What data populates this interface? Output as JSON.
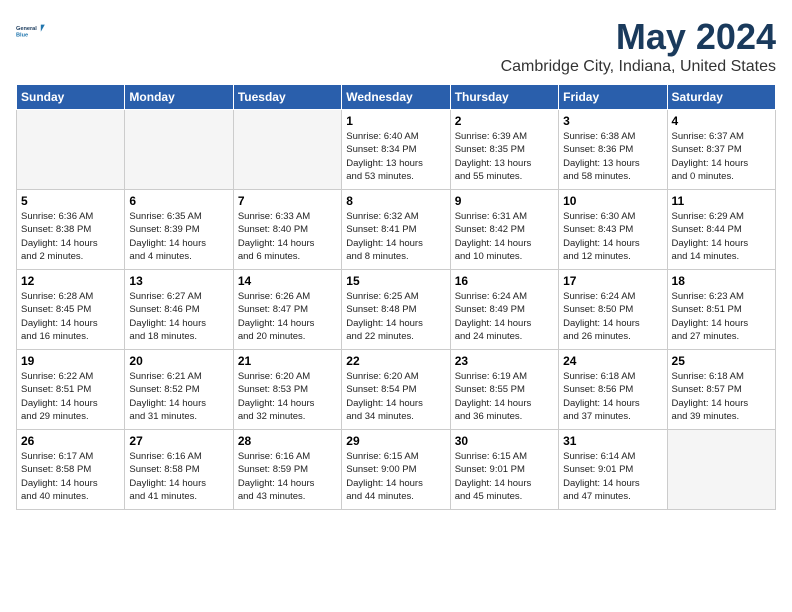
{
  "header": {
    "logo_line1": "General",
    "logo_line2": "Blue",
    "month_year": "May 2024",
    "location": "Cambridge City, Indiana, United States"
  },
  "weekdays": [
    "Sunday",
    "Monday",
    "Tuesday",
    "Wednesday",
    "Thursday",
    "Friday",
    "Saturday"
  ],
  "weeks": [
    [
      {
        "day": "",
        "info": ""
      },
      {
        "day": "",
        "info": ""
      },
      {
        "day": "",
        "info": ""
      },
      {
        "day": "1",
        "info": "Sunrise: 6:40 AM\nSunset: 8:34 PM\nDaylight: 13 hours\nand 53 minutes."
      },
      {
        "day": "2",
        "info": "Sunrise: 6:39 AM\nSunset: 8:35 PM\nDaylight: 13 hours\nand 55 minutes."
      },
      {
        "day": "3",
        "info": "Sunrise: 6:38 AM\nSunset: 8:36 PM\nDaylight: 13 hours\nand 58 minutes."
      },
      {
        "day": "4",
        "info": "Sunrise: 6:37 AM\nSunset: 8:37 PM\nDaylight: 14 hours\nand 0 minutes."
      }
    ],
    [
      {
        "day": "5",
        "info": "Sunrise: 6:36 AM\nSunset: 8:38 PM\nDaylight: 14 hours\nand 2 minutes."
      },
      {
        "day": "6",
        "info": "Sunrise: 6:35 AM\nSunset: 8:39 PM\nDaylight: 14 hours\nand 4 minutes."
      },
      {
        "day": "7",
        "info": "Sunrise: 6:33 AM\nSunset: 8:40 PM\nDaylight: 14 hours\nand 6 minutes."
      },
      {
        "day": "8",
        "info": "Sunrise: 6:32 AM\nSunset: 8:41 PM\nDaylight: 14 hours\nand 8 minutes."
      },
      {
        "day": "9",
        "info": "Sunrise: 6:31 AM\nSunset: 8:42 PM\nDaylight: 14 hours\nand 10 minutes."
      },
      {
        "day": "10",
        "info": "Sunrise: 6:30 AM\nSunset: 8:43 PM\nDaylight: 14 hours\nand 12 minutes."
      },
      {
        "day": "11",
        "info": "Sunrise: 6:29 AM\nSunset: 8:44 PM\nDaylight: 14 hours\nand 14 minutes."
      }
    ],
    [
      {
        "day": "12",
        "info": "Sunrise: 6:28 AM\nSunset: 8:45 PM\nDaylight: 14 hours\nand 16 minutes."
      },
      {
        "day": "13",
        "info": "Sunrise: 6:27 AM\nSunset: 8:46 PM\nDaylight: 14 hours\nand 18 minutes."
      },
      {
        "day": "14",
        "info": "Sunrise: 6:26 AM\nSunset: 8:47 PM\nDaylight: 14 hours\nand 20 minutes."
      },
      {
        "day": "15",
        "info": "Sunrise: 6:25 AM\nSunset: 8:48 PM\nDaylight: 14 hours\nand 22 minutes."
      },
      {
        "day": "16",
        "info": "Sunrise: 6:24 AM\nSunset: 8:49 PM\nDaylight: 14 hours\nand 24 minutes."
      },
      {
        "day": "17",
        "info": "Sunrise: 6:24 AM\nSunset: 8:50 PM\nDaylight: 14 hours\nand 26 minutes."
      },
      {
        "day": "18",
        "info": "Sunrise: 6:23 AM\nSunset: 8:51 PM\nDaylight: 14 hours\nand 27 minutes."
      }
    ],
    [
      {
        "day": "19",
        "info": "Sunrise: 6:22 AM\nSunset: 8:51 PM\nDaylight: 14 hours\nand 29 minutes."
      },
      {
        "day": "20",
        "info": "Sunrise: 6:21 AM\nSunset: 8:52 PM\nDaylight: 14 hours\nand 31 minutes."
      },
      {
        "day": "21",
        "info": "Sunrise: 6:20 AM\nSunset: 8:53 PM\nDaylight: 14 hours\nand 32 minutes."
      },
      {
        "day": "22",
        "info": "Sunrise: 6:20 AM\nSunset: 8:54 PM\nDaylight: 14 hours\nand 34 minutes."
      },
      {
        "day": "23",
        "info": "Sunrise: 6:19 AM\nSunset: 8:55 PM\nDaylight: 14 hours\nand 36 minutes."
      },
      {
        "day": "24",
        "info": "Sunrise: 6:18 AM\nSunset: 8:56 PM\nDaylight: 14 hours\nand 37 minutes."
      },
      {
        "day": "25",
        "info": "Sunrise: 6:18 AM\nSunset: 8:57 PM\nDaylight: 14 hours\nand 39 minutes."
      }
    ],
    [
      {
        "day": "26",
        "info": "Sunrise: 6:17 AM\nSunset: 8:58 PM\nDaylight: 14 hours\nand 40 minutes."
      },
      {
        "day": "27",
        "info": "Sunrise: 6:16 AM\nSunset: 8:58 PM\nDaylight: 14 hours\nand 41 minutes."
      },
      {
        "day": "28",
        "info": "Sunrise: 6:16 AM\nSunset: 8:59 PM\nDaylight: 14 hours\nand 43 minutes."
      },
      {
        "day": "29",
        "info": "Sunrise: 6:15 AM\nSunset: 9:00 PM\nDaylight: 14 hours\nand 44 minutes."
      },
      {
        "day": "30",
        "info": "Sunrise: 6:15 AM\nSunset: 9:01 PM\nDaylight: 14 hours\nand 45 minutes."
      },
      {
        "day": "31",
        "info": "Sunrise: 6:14 AM\nSunset: 9:01 PM\nDaylight: 14 hours\nand 47 minutes."
      },
      {
        "day": "",
        "info": ""
      }
    ]
  ]
}
